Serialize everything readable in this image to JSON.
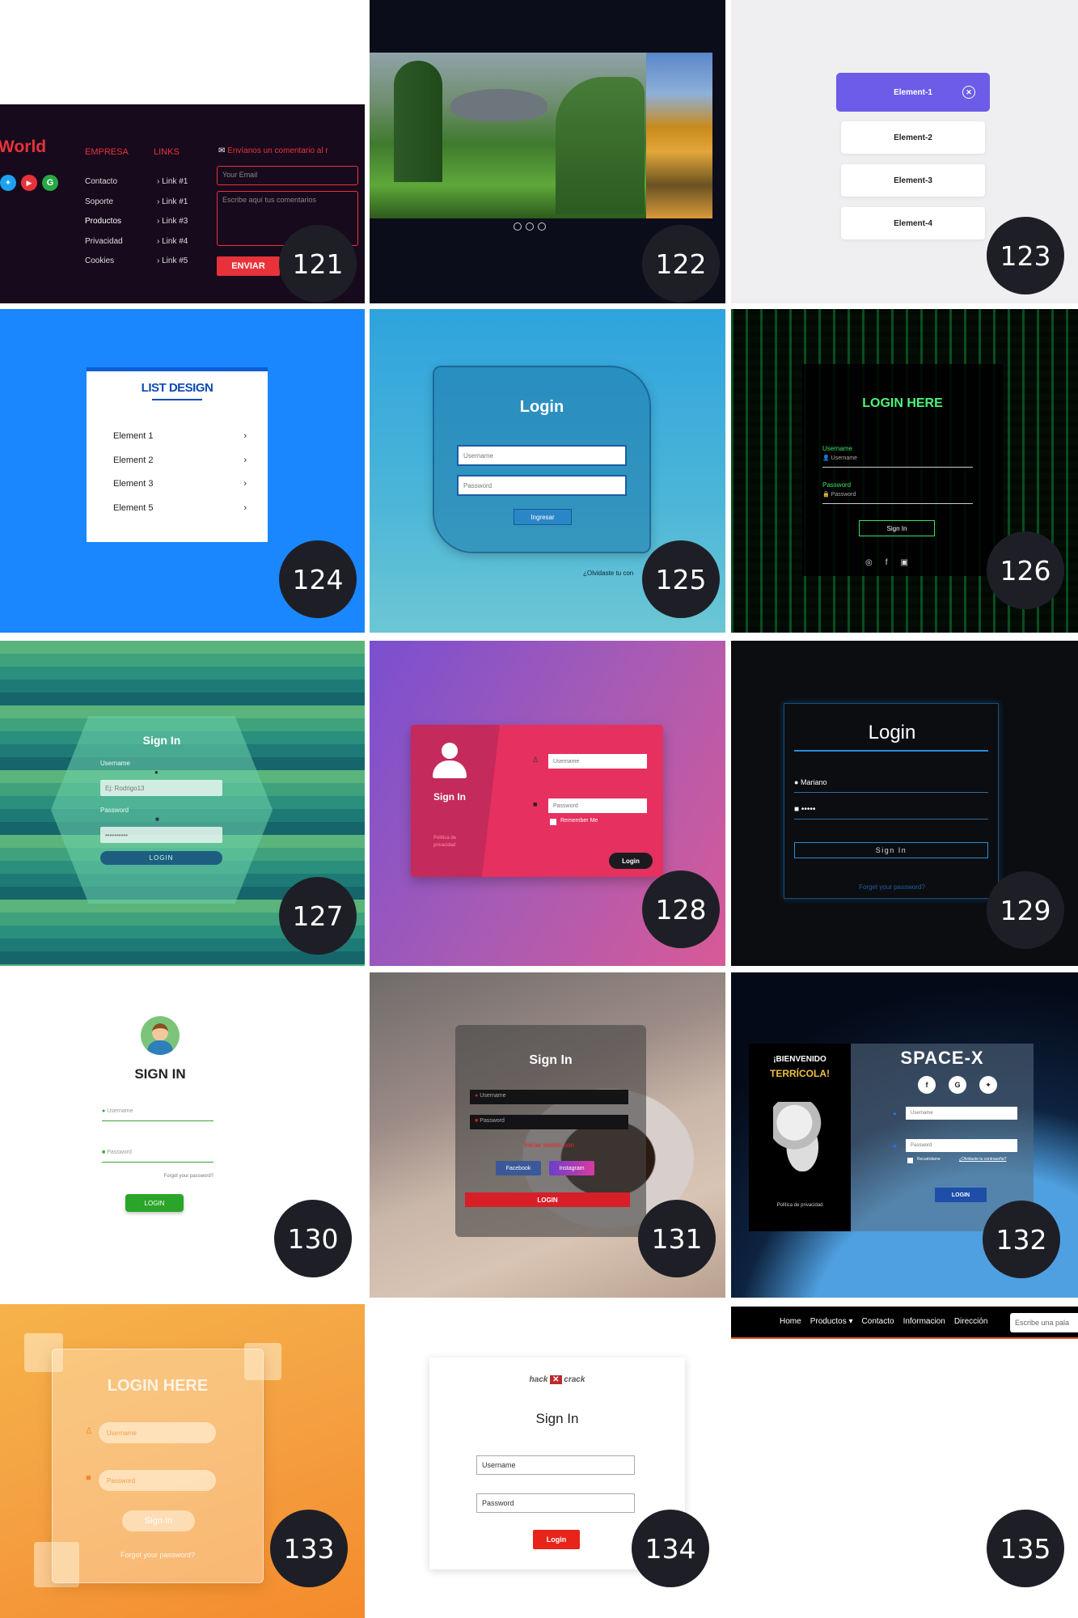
{
  "colors": {
    "accent_purple": "#6c5ce7",
    "badge": "#1e1f26",
    "red": "#e8323a",
    "blue": "#1a87ff"
  },
  "t121": {
    "brand": "World",
    "col1_title": "EMPRESA",
    "col1_items": [
      "Contacto",
      "Soporte",
      "Productos",
      "Privacidad",
      "Cookies"
    ],
    "col2_title": "LINKS",
    "col2_items": [
      "Link #1",
      "Link #1",
      "Link #3",
      "Link #4",
      "Link #5"
    ],
    "form_title": "Envíanos un comentario al r",
    "email_placeholder": "Your Email",
    "comment_placeholder": "Escribe aquí tus comentarios",
    "submit": "ENVIAR",
    "number": "121"
  },
  "t122": {
    "number": "122",
    "dots": 3
  },
  "t123": {
    "items": [
      "Element-1",
      "Element-2",
      "Element-3",
      "Element-4"
    ],
    "number": "123"
  },
  "t124": {
    "title": "LIST DESIGN",
    "items": [
      "Element 1",
      "Element 2",
      "Element 3",
      "Element 5"
    ],
    "number": "124"
  },
  "t125": {
    "title": "Login",
    "username": "Username",
    "password": "Password",
    "submit": "Ingresar",
    "forgot": "¿Olvidaste tu con",
    "number": "125"
  },
  "t126": {
    "title": "LOGIN HERE",
    "user_label": "Username",
    "user_placeholder": "Username",
    "pass_label": "Password",
    "pass_placeholder": "Password",
    "submit": "Sign In",
    "number": "126"
  },
  "t127": {
    "title": "Sign In",
    "user_label": "Username",
    "user_placeholder": "Ej: Rodrigo13",
    "pass_label": "Password",
    "pass_value": "••••••••••",
    "submit": "LOGIN",
    "number": "127"
  },
  "t128": {
    "title": "Sign In",
    "policy": "Política de privacidad",
    "username": "Username",
    "password": "Password",
    "remember": "Remember Me",
    "submit": "Login",
    "number": "128"
  },
  "t129": {
    "title": "Login",
    "user_value": "Mariano",
    "pass_value": "•••••",
    "submit": "Sign In",
    "forgot": "Forget your password?",
    "number": "129"
  },
  "t130": {
    "title": "SIGN IN",
    "username": "Username",
    "password": "Password",
    "forgot": "Forgot your password?",
    "submit": "LOGIN",
    "number": "130"
  },
  "t131": {
    "title": "Sign In",
    "username": "Username",
    "password": "Password",
    "alt": "Iniciar sesión con",
    "facebook": "Facebook",
    "instagram": "Instagram",
    "submit": "LOGIN",
    "number": "131"
  },
  "t132": {
    "welcome": "¡BIENVENIDO",
    "welcome2": "TERRÍCOLA!",
    "policy": "Política de privacidad",
    "title": "SPACE-X",
    "username": "Username",
    "password": "Password",
    "remember": "Recuérdame",
    "forgot": "¿Olvidaste tu contraseña?",
    "submit": "LOGIN",
    "number": "132"
  },
  "t133": {
    "title": "LOGIN HERE",
    "username": "Username",
    "password": "Password",
    "submit": "Sign In",
    "forgot": "Forgot your password?",
    "number": "133"
  },
  "t134": {
    "logo_left": "hack",
    "logo_right": "crack",
    "title": "Sign In",
    "username": "Username",
    "password": "Password",
    "submit": "Login",
    "number": "134"
  },
  "t135": {
    "nav": [
      "Home",
      "Productos",
      "Contacto",
      "Informacion",
      "Dirección"
    ],
    "search_placeholder": "Escribe una pala",
    "number": "135"
  }
}
